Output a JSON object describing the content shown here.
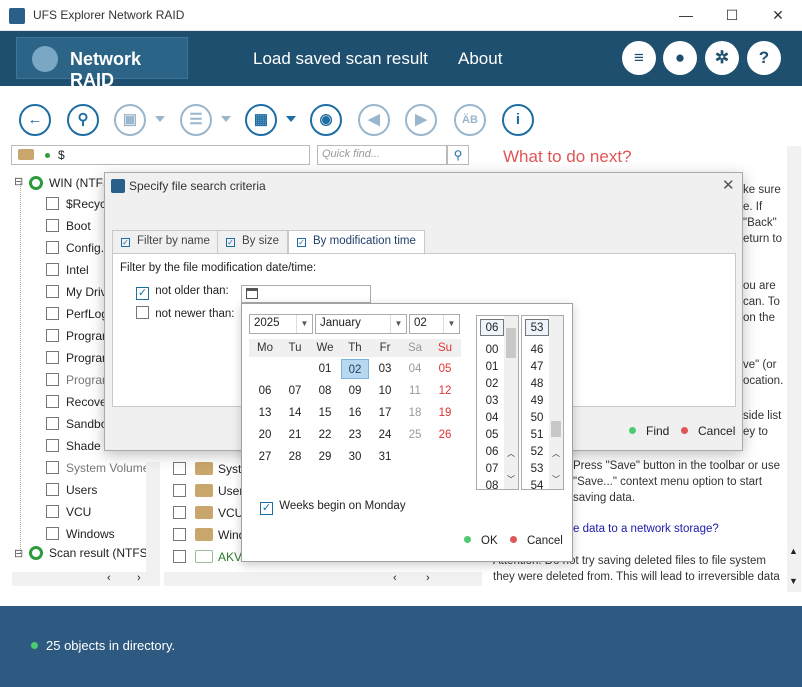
{
  "window": {
    "title": "UFS Explorer Network RAID",
    "minimize": "—",
    "maximize": "☐",
    "close": "✕"
  },
  "header": {
    "brand": "Network RAID",
    "nav": [
      "Load saved scan result",
      "About"
    ],
    "icons": [
      "list-icon",
      "user-icon",
      "gear-icon",
      "help-icon"
    ],
    "help_glyph": "?"
  },
  "toolbar": {
    "buttons": [
      "back",
      "find",
      "save",
      "select",
      "view",
      "search-binoculars",
      "prev",
      "next",
      "spell",
      "info"
    ]
  },
  "path": {
    "value": "$"
  },
  "quickfind": {
    "placeholder": "Quick find..."
  },
  "tree": {
    "root": "WIN (NTFS",
    "items": [
      "$Recycl",
      "Boot",
      "Config.M",
      "Intel",
      "My Driv",
      "PerfLog",
      "Program",
      "Program",
      "Program",
      "Recover",
      "Sandbo",
      "Shade",
      "System Volume I",
      "Users",
      "VCU",
      "Windows"
    ],
    "root2": "Scan result (NTFS fil"
  },
  "files": [
    {
      "name": "Syst",
      "type": "folder"
    },
    {
      "name": "User",
      "type": "folder"
    },
    {
      "name": "VCU",
      "type": "folder"
    },
    {
      "name": "Wind",
      "type": "folder"
    },
    {
      "name": "AKVa",
      "type": "file"
    }
  ],
  "right_panel": {
    "heading": "What to do next?",
    "fragments": [
      "ke sure",
      "e.  If",
      "\"Back\"",
      "eturn to",
      "ou are",
      "can. To",
      "on the",
      "ve\"  (or",
      "ocation.",
      "side list",
      "ey to"
    ],
    "save_text_1": "Press \"Save\" button in the toolbar or use",
    "save_text_2": "\"Save...\" context menu option to start",
    "save_text_3": "saving data.",
    "link": "e data to a network storage?",
    "attention_1": "Attention: Do not try saving deleted files to file system",
    "attention_2": "they were deleted from. This will lead to irreversible data"
  },
  "status": {
    "text": "25 objects in directory."
  },
  "dialog": {
    "title": "Specify file search criteria",
    "tabs": [
      {
        "label": "Filter by name",
        "active": false
      },
      {
        "label": "By size",
        "active": false
      },
      {
        "label": "By modification time",
        "active": true
      }
    ],
    "caption": "Filter by the file modification date/time:",
    "not_older": {
      "label": "not older than:",
      "checked": true
    },
    "not_newer": {
      "label": "not newer than:",
      "checked": false
    },
    "find": "Find",
    "cancel": "Cancel"
  },
  "calendar": {
    "year": "2025",
    "month": "January",
    "day": "02",
    "weekdays": [
      "Mo",
      "Tu",
      "We",
      "Th",
      "Fr",
      "Sa",
      "Su"
    ],
    "weeks": [
      [
        "",
        "",
        "01",
        "02",
        "03",
        "04",
        "05"
      ],
      [
        "06",
        "07",
        "08",
        "09",
        "10",
        "11",
        "12"
      ],
      [
        "13",
        "14",
        "15",
        "16",
        "17",
        "18",
        "19"
      ],
      [
        "20",
        "21",
        "22",
        "23",
        "24",
        "25",
        "26"
      ],
      [
        "27",
        "28",
        "29",
        "30",
        "31",
        "",
        ""
      ]
    ],
    "today": "02",
    "hours": [
      "06",
      "00",
      "01",
      "02",
      "03",
      "04",
      "05",
      "06",
      "07",
      "08"
    ],
    "minutes": [
      "53",
      "46",
      "47",
      "48",
      "49",
      "50",
      "51",
      "52",
      "53",
      "54"
    ],
    "weeks_begin_monday": {
      "label": "Weeks begin on Monday",
      "checked": true
    },
    "ok": "OK",
    "cancel": "Cancel"
  },
  "colors": {
    "header": "#1e4f6e",
    "status": "#2e5a82",
    "accent": "#1f6ea3",
    "heading": "#e05555",
    "ok_dot": "#4ccc70",
    "cancel_dot": "#e05555"
  }
}
